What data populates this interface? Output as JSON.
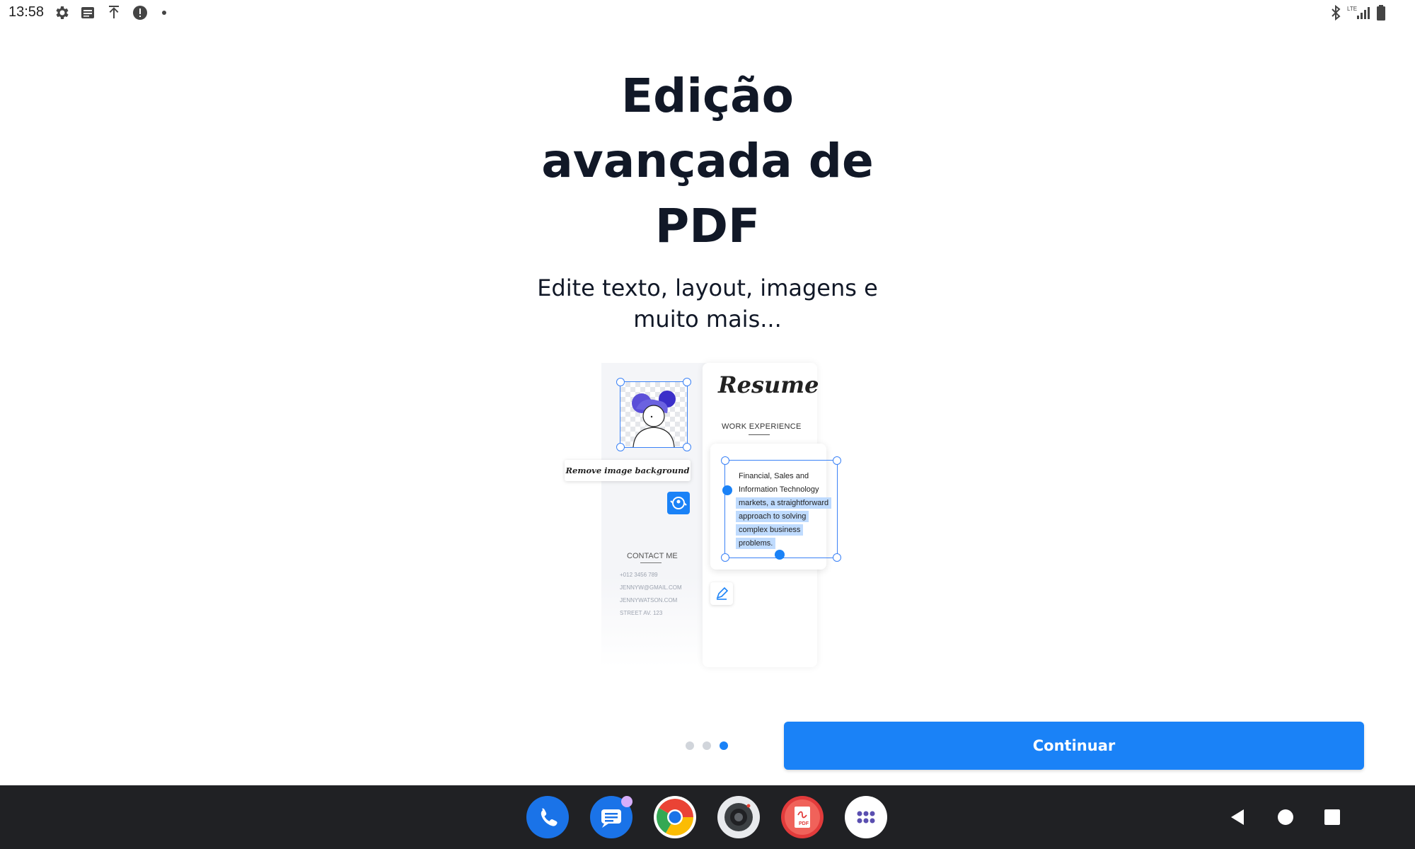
{
  "status_bar": {
    "time": "13:58",
    "left_icons": [
      "settings-icon",
      "news-icon",
      "upload-icon",
      "alert-icon"
    ],
    "right_icons": [
      "bluetooth-icon",
      "lte-signal-icon",
      "battery-icon"
    ]
  },
  "onboarding": {
    "title": "Edição avançada de PDF",
    "subtitle": "Edite texto, layout, imagens e muito mais...",
    "page_indicator": {
      "total": 3,
      "active": 3
    },
    "continue_label": "Continuar"
  },
  "illustration": {
    "resume_title": "Resume",
    "work_experience": "WORK EXPERIENCE",
    "remove_bg_label": "Remove image background",
    "text_lines": [
      "Financial, Sales and",
      "Information Technology",
      "markets, a straightforward",
      "approach to solving",
      "complex business",
      "problems."
    ],
    "contact_title": "CONTACT ME",
    "contact_lines": [
      "+012 3456 789",
      "JENNYW@GMAIL.COM",
      "JENNYWATSON.COM",
      "STREET AV. 123"
    ]
  },
  "dock": {
    "apps": [
      "phone-icon",
      "messages-icon",
      "chrome-icon",
      "camera-icon",
      "pdf-app-icon",
      "app-drawer-icon"
    ]
  },
  "navigation": [
    "back-button",
    "home-button",
    "recents-button"
  ],
  "colors": {
    "accent": "#1a82f7",
    "nav_bar": "#202124",
    "title_text": "#111827"
  }
}
